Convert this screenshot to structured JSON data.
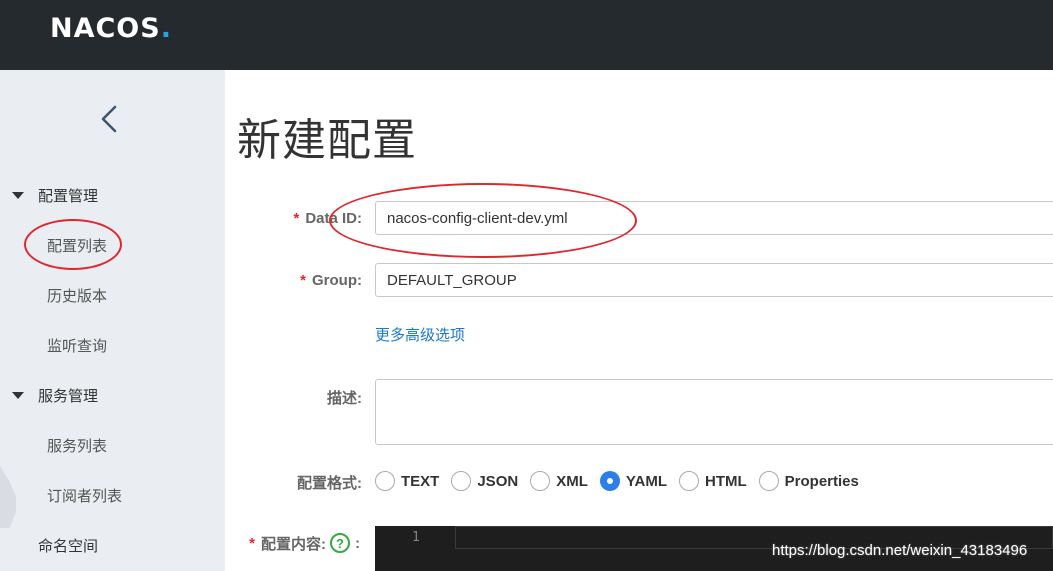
{
  "header": {
    "logo_text": "NACOS",
    "logo_dot": "."
  },
  "sidebar": {
    "collapse_icon": "chevron-left-icon",
    "groups": [
      {
        "label": "配置管理",
        "items": [
          "配置列表",
          "历史版本",
          "监听查询"
        ]
      },
      {
        "label": "服务管理",
        "items": [
          "服务列表",
          "订阅者列表"
        ]
      }
    ],
    "namespace": "命名空间"
  },
  "page": {
    "title": "新建配置"
  },
  "form": {
    "data_id": {
      "label": "Data ID:",
      "value": "nacos-config-client-dev.yml"
    },
    "group": {
      "label": "Group:",
      "value": "DEFAULT_GROUP"
    },
    "advanced_link": "更多高级选项",
    "description": {
      "label": "描述:",
      "value": ""
    },
    "format": {
      "label": "配置格式:",
      "options": [
        "TEXT",
        "JSON",
        "XML",
        "YAML",
        "HTML",
        "Properties"
      ],
      "selected": "YAML"
    },
    "content": {
      "label": "配置内容:",
      "colon": ":",
      "help_icon": "?",
      "line_number": "1"
    }
  },
  "required_mark": "*",
  "watermark": "https://blog.csdn.net/weixin_43183496",
  "colors": {
    "accent": "#2b7fe6",
    "link": "#1a7ad1",
    "required": "#e0262f",
    "header_bg": "#252a2f",
    "annotation": "#e0262f"
  }
}
